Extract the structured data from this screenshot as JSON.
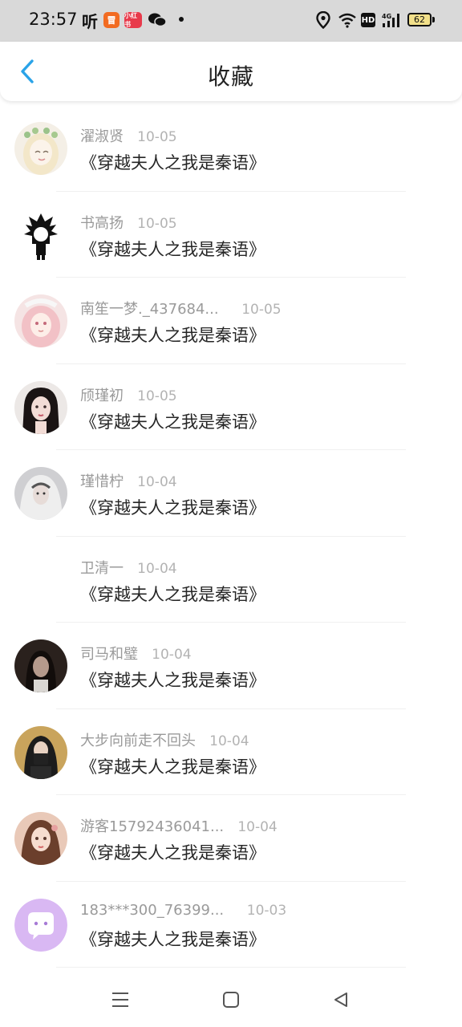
{
  "status_bar": {
    "time": "23:57",
    "app_icons": [
      "tingwen-icon",
      "red-app-icon",
      "pink-app-icon",
      "wechat-icon"
    ],
    "tingwen_glyph": "听",
    "red_app_glyph": "冒",
    "pink_app_glyph": "小红书",
    "hd_label": "HD",
    "network_label": "4G",
    "battery_level": "62"
  },
  "header": {
    "title": "收藏",
    "back_icon": "chevron-left-icon",
    "accent_color": "#2aa3e8"
  },
  "list": [
    {
      "name": "濯淑贤",
      "time": "10-05",
      "title": "《穿越夫人之我是秦语》",
      "avatar": "anime-girl-flower-crown"
    },
    {
      "name": "书高扬",
      "time": "10-05",
      "title": "《穿越夫人之我是秦语》",
      "avatar": "anime-boy-black-hair"
    },
    {
      "name": "南笙一梦._437684...",
      "time": "10-05",
      "title": "《穿越夫人之我是秦语》",
      "avatar": "anime-girl-pink-hair"
    },
    {
      "name": "颀瑾初",
      "time": "10-05",
      "title": "《穿越夫人之我是秦语》",
      "avatar": "girl-portrait-dark-hair"
    },
    {
      "name": "瑾惜柠",
      "time": "10-04",
      "title": "《穿越夫人之我是秦语》",
      "avatar": "girl-white-veil"
    },
    {
      "name": "卫清一",
      "time": "10-04",
      "title": "《穿越夫人之我是秦语》",
      "avatar": "blank"
    },
    {
      "name": "司马和璧",
      "time": "10-04",
      "title": "《穿越夫人之我是秦语》",
      "avatar": "girl-dark-photo"
    },
    {
      "name": "大步向前走不回头",
      "time": "10-04",
      "title": "《穿越夫人之我是秦语》",
      "avatar": "person-mirror-selfie"
    },
    {
      "name": "游客15792436041...",
      "time": "10-04",
      "title": "《穿越夫人之我是秦语》",
      "avatar": "girl-illustration"
    },
    {
      "name": "183***300_76399...",
      "time": "10-03",
      "title": "《穿越夫人之我是秦语》",
      "avatar": "purple-chat-bubble"
    }
  ],
  "nav_bar": {
    "icons": [
      "menu-icon",
      "home-square-icon",
      "back-triangle-icon"
    ]
  }
}
